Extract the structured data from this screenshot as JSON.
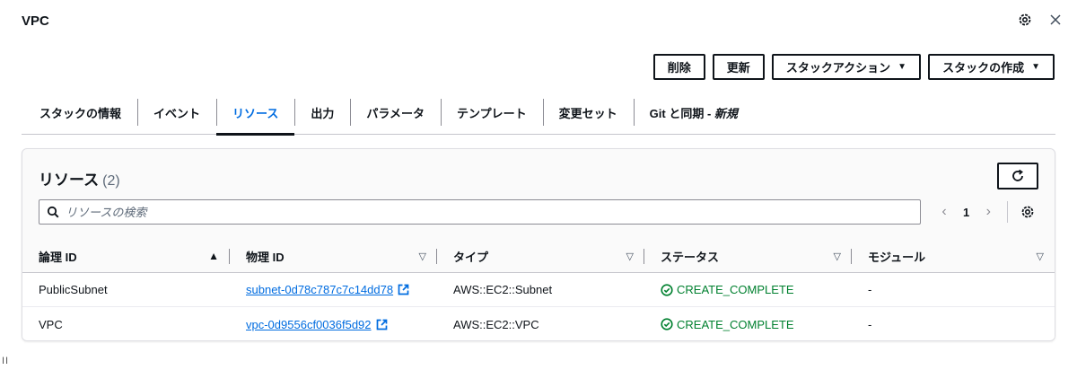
{
  "header": {
    "title": "VPC"
  },
  "icons": {
    "settings": "gear-icon",
    "close": "close-icon"
  },
  "actions": {
    "delete_label": "削除",
    "update_label": "更新",
    "stack_actions_label": "スタックアクション",
    "create_stack_label": "スタックの作成"
  },
  "tabs": [
    {
      "label": "スタックの情報"
    },
    {
      "label": "イベント"
    },
    {
      "label": "リソース"
    },
    {
      "label": "出力"
    },
    {
      "label": "パラメータ"
    },
    {
      "label": "テンプレート"
    },
    {
      "label": "変更セット"
    },
    {
      "label": "Git と同期 - ",
      "suffix": "新規"
    }
  ],
  "active_tab": "リソース",
  "resources": {
    "title": "リソース",
    "count": "(2)",
    "search_placeholder": "リソースの検索",
    "page": "1",
    "columns": [
      "論理 ID",
      "物理 ID",
      "タイプ",
      "ステータス",
      "モジュール"
    ],
    "rows": [
      {
        "logical_id": "PublicSubnet",
        "physical_id": "subnet-0d78c787c7c14dd78",
        "type": "AWS::EC2::Subnet",
        "status": "CREATE_COMPLETE",
        "module": "-"
      },
      {
        "logical_id": "VPC",
        "physical_id": "vpc-0d9556cf0036f5d92",
        "type": "AWS::EC2::VPC",
        "status": "CREATE_COMPLETE",
        "module": "-"
      }
    ]
  },
  "colors": {
    "link": "#006ce0",
    "success": "#00802f",
    "text": "#0f141a"
  },
  "footer": {
    "mark": "II"
  }
}
